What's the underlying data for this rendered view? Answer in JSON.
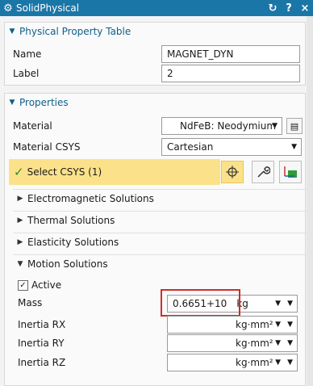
{
  "window": {
    "title": "SolidPhysical",
    "reset_icon": "reset-icon",
    "help_label": "?",
    "close_label": "×"
  },
  "physical_table": {
    "header": "Physical Property Table",
    "name_label": "Name",
    "name_value": "MAGNET_DYN",
    "label_label": "Label",
    "label_value": "2"
  },
  "properties": {
    "header": "Properties",
    "material_label": "Material",
    "material_value": "NdFeB: Neodymium",
    "material_csys_label": "Material CSYS",
    "material_csys_value": "Cartesian",
    "select_csys_label": "Select CSYS (1)",
    "subsections": [
      "Electromagnetic Solutions",
      "Thermal Solutions",
      "Elasticity Solutions",
      "Motion Solutions"
    ],
    "motion": {
      "active_label": "Active",
      "mass_label": "Mass",
      "mass_value": "0.6651+10",
      "mass_unit": "kg",
      "inertia_rx_label": "Inertia RX",
      "inertia_ry_label": "Inertia RY",
      "inertia_rz_label": "Inertia RZ",
      "inertia_unit": "kg·mm²"
    }
  }
}
